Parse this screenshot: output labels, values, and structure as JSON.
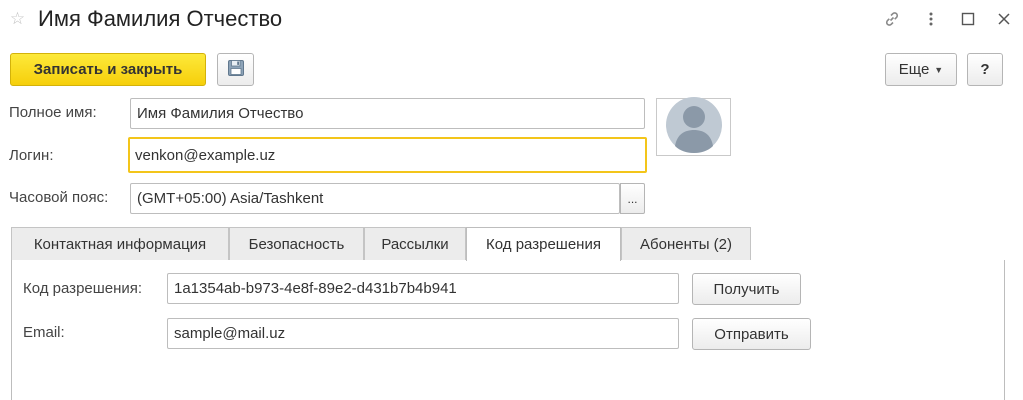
{
  "window": {
    "title": "Имя Фамилия Отчество"
  },
  "toolbar": {
    "save_close_label": "Записать и закрыть",
    "more_label": "Еще",
    "help_label": "?"
  },
  "form": {
    "full_name": {
      "label": "Полное имя:",
      "value": "Имя Фамилия Отчество"
    },
    "login": {
      "label": "Логин:",
      "value": "venkon@example.uz"
    },
    "timezone": {
      "label": "Часовой пояс:",
      "value": "(GMT+05:00) Asia/Tashkent",
      "choose_label": "..."
    }
  },
  "tabs": [
    {
      "label": "Контактная информация",
      "active": false
    },
    {
      "label": "Безопасность",
      "active": false
    },
    {
      "label": "Рассылки",
      "active": false
    },
    {
      "label": "Код разрешения",
      "active": true
    },
    {
      "label": "Абоненты (2)",
      "active": false
    }
  ],
  "permission": {
    "code": {
      "label": "Код разрешения:",
      "value": "1a1354ab-b973-4e8f-89e2-d431b7b4b941",
      "button_label": "Получить"
    },
    "email": {
      "label": "Email:",
      "value": "sample@mail.uz",
      "button_label": "Отправить"
    }
  },
  "colors": {
    "accent": "#f6cf0b",
    "focus_border": "#f3c51a"
  },
  "icons": [
    "star-icon",
    "link-icon",
    "more-vertical-icon",
    "maximize-icon",
    "close-icon",
    "save-disk-icon",
    "chevron-down-icon",
    "avatar-placeholder-icon"
  ]
}
